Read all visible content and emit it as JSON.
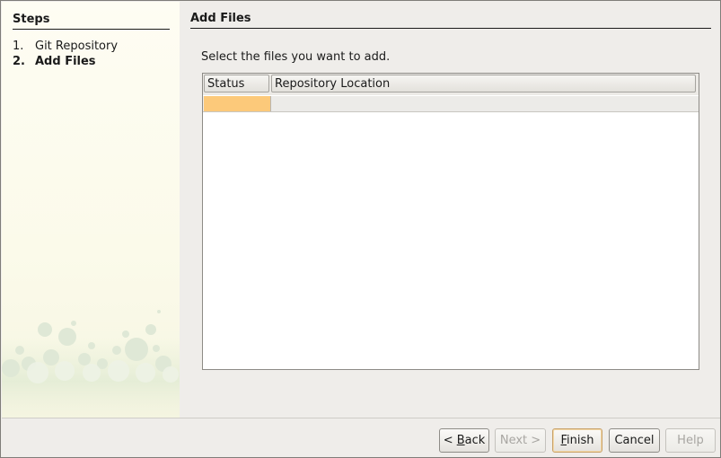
{
  "sidebar": {
    "title": "Steps",
    "steps": [
      {
        "num": "1.",
        "label": "Git Repository"
      },
      {
        "num": "2.",
        "label": "Add Files"
      }
    ]
  },
  "main": {
    "title": "Add Files",
    "instruction": "Select the files you want to add.",
    "table": {
      "columns": [
        "Status",
        "Repository Location"
      ],
      "rows": [
        {
          "status": "",
          "location": ""
        }
      ]
    }
  },
  "buttons": {
    "back": {
      "prefix": "< ",
      "mnemonic": "B",
      "rest": "ack"
    },
    "next": {
      "label": "Next >"
    },
    "finish": {
      "mnemonic": "F",
      "rest": "inish"
    },
    "cancel": {
      "label": "Cancel"
    },
    "help": {
      "label": "Help"
    }
  },
  "colors": {
    "sidebar_bg": "#fdfcf0",
    "selected_cell": "#fcc97a",
    "dialog_bg": "#efedea"
  }
}
